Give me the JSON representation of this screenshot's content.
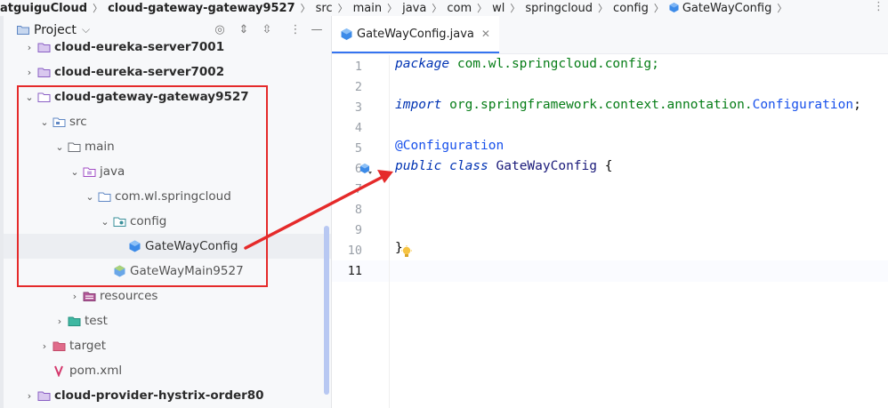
{
  "breadcrumb": {
    "items": [
      "atguiguCloud",
      "cloud-gateway-gateway9527",
      "src",
      "main",
      "java",
      "com",
      "wl",
      "springcloud",
      "config",
      "GateWayConfig"
    ],
    "separator": "〉"
  },
  "project_panel": {
    "title": "Project",
    "tree": [
      {
        "label": "cloud-eureka-server7001",
        "icon": "module-folder-icon"
      },
      {
        "label": "cloud-eureka-server7002",
        "icon": "module-folder-icon"
      },
      {
        "label": "cloud-gateway-gateway9527",
        "icon": "module-folder-icon"
      },
      {
        "label": "src",
        "icon": "source-folder-icon"
      },
      {
        "label": "main",
        "icon": "folder-icon"
      },
      {
        "label": "java",
        "icon": "java-source-folder-icon"
      },
      {
        "label": "com.wl.springcloud",
        "icon": "package-icon"
      },
      {
        "label": "config",
        "icon": "package-icon"
      },
      {
        "label": "GateWayConfig",
        "icon": "java-class-icon"
      },
      {
        "label": "GateWayMain9527",
        "icon": "spring-boot-class-icon"
      },
      {
        "label": "resources",
        "icon": "resources-folder-icon"
      },
      {
        "label": "test",
        "icon": "test-folder-icon"
      },
      {
        "label": "target",
        "icon": "target-folder-icon"
      },
      {
        "label": "pom.xml",
        "icon": "maven-icon"
      },
      {
        "label": "cloud-provider-hystrix-order80",
        "icon": "module-folder-icon"
      }
    ]
  },
  "editor": {
    "tab_label": "GateWayConfig.java",
    "line_numbers": [
      "1",
      "2",
      "3",
      "4",
      "5",
      "6",
      "7",
      "8",
      "9",
      "10",
      "11"
    ],
    "code": {
      "l1_kw": "package",
      "l1_rest": " com.wl.springcloud.config;",
      "l3_kw": "import",
      "l3_pkg": " org.springframework.context.annotation.",
      "l3_cls": "Configuration",
      "l3_end": ";",
      "l5_ann": "@Configuration",
      "l6_kw1": "public",
      "l6_kw2": " class",
      "l6_name": " GateWayConfig",
      "l6_brace": " {",
      "l10_brace": "}"
    }
  },
  "colors": {
    "annotation_box": "#e52a2a",
    "arrow": "#e52a2a",
    "keyword": "#0033b3",
    "annotation": "#1750eb",
    "package": "#067d17",
    "accent": "#3574f0"
  }
}
